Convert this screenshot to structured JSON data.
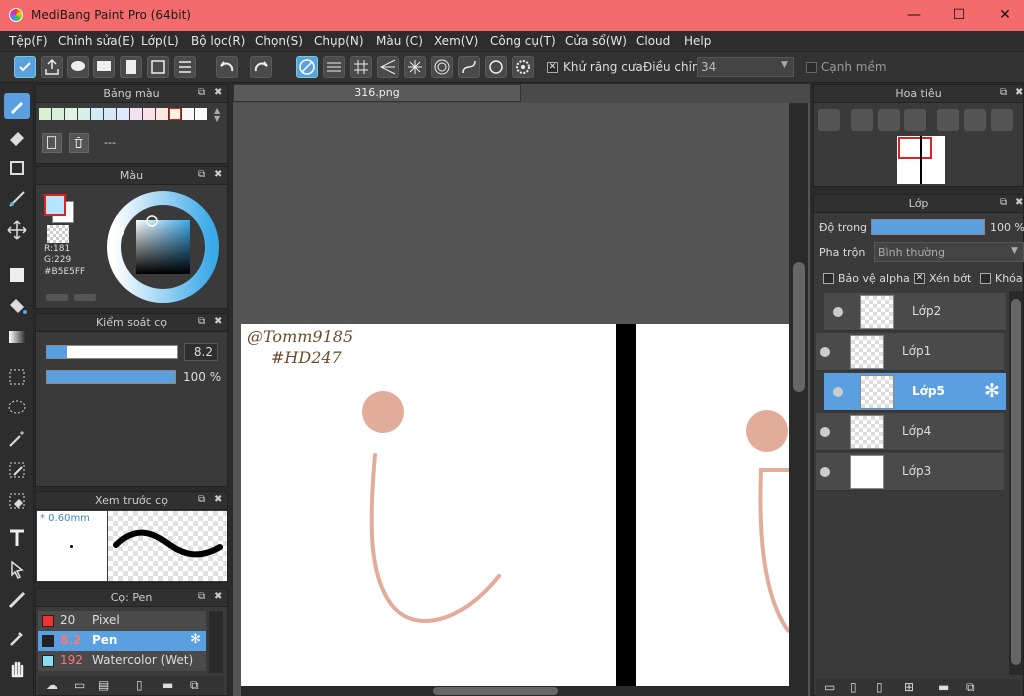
{
  "window": {
    "title": "MediBang Paint Pro (64bit)",
    "minimize": "—",
    "maximize": "☐",
    "close": "✕"
  },
  "menu": [
    "Tệp(F)",
    "Chỉnh sửa(E)",
    "Lớp(L)",
    "Bộ lọc(R)",
    "Chọn(S)",
    "Chụp(N)",
    "Màu (C)",
    "Xem(V)",
    "Công cụ(T)",
    "Cửa sổ(W)",
    "Cloud",
    "Help"
  ],
  "toolbar": {
    "antialias_label": "Khử răng cưa",
    "adjust_label": "Điều chỉnh",
    "adjust_value": "34",
    "soft_edge_label": "Cạnh mềm"
  },
  "palette_panel": {
    "title": "Bảng màu",
    "text": "---"
  },
  "color_panel": {
    "title": "Màu",
    "r": "R:181",
    "g": "G:229",
    "hex": "#B5E5FF",
    "current": "#B5E5FF"
  },
  "brush_control": {
    "title": "Kiểm soát cọ",
    "size": "8.2",
    "opacity": "100 %"
  },
  "brush_preview": {
    "title": "Xem trước cọ",
    "size": "* 0.60mm"
  },
  "brush_list": {
    "title": "Cọ: Pen",
    "items": [
      {
        "size": "20",
        "name": "Pixel",
        "color": "#e33"
      },
      {
        "size": "8.2",
        "name": "Pen",
        "color": "#222"
      },
      {
        "size": "192",
        "name": "Watercolor (Wet)",
        "color": "#8de"
      }
    ]
  },
  "document": {
    "tab": "316.png",
    "signature_line1": "@Tomm9185",
    "signature_line2": "#HD247"
  },
  "navigator": {
    "title": "Hoa tiêu"
  },
  "layers": {
    "title": "Lớp",
    "opacity_label": "Độ trong",
    "opacity_value": "100 %",
    "opacity": 1.0,
    "blend_label": "Pha trộn",
    "blend_value": "Bình thường",
    "protect_alpha": "Bảo vệ alpha",
    "clip": "Xén bớt",
    "lock": "Khóa",
    "items": [
      "Lớp2",
      "Lớp1",
      "Lớp5",
      "Lớp4",
      "Lớp3"
    ]
  }
}
